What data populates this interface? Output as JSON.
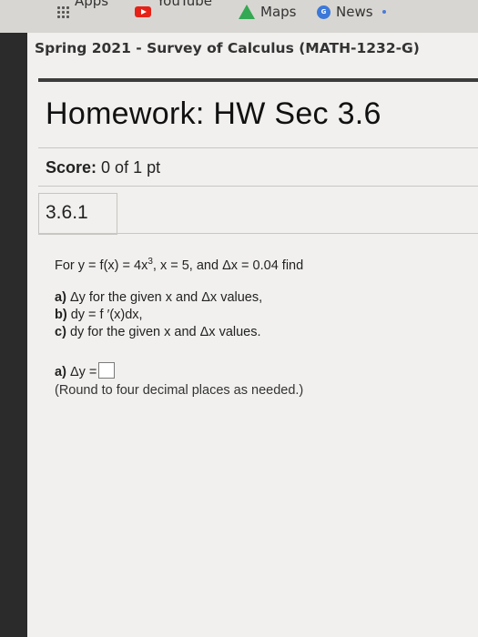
{
  "bookmarks": [
    {
      "label": "Apps",
      "icon": "apps-grid-icon"
    },
    {
      "label": "YouTube",
      "icon": "youtube-icon"
    },
    {
      "label": "Maps",
      "icon": "maps-icon"
    },
    {
      "label": "News",
      "icon": "news-icon"
    }
  ],
  "course": {
    "title": "Spring 2021 - Survey of Calculus (MATH-1232-G)"
  },
  "homework": {
    "title": "Homework: HW Sec 3.6"
  },
  "score": {
    "label": "Score:",
    "value": "0 of 1 pt"
  },
  "question": {
    "number": "3.6.1",
    "prompt_start": "For y = f(x) = 4x",
    "prompt_exp": "3",
    "prompt_end": ", x = 5, and Δx = 0.04 find",
    "parts": [
      {
        "label": "a)",
        "text": "Δy for the given x and Δx values,"
      },
      {
        "label": "b)",
        "text": "dy = f ′(x)dx,"
      },
      {
        "label": "c)",
        "text": "dy for the given x and Δx values."
      }
    ],
    "answer_label": "a)",
    "answer_text": "Δy =",
    "answer_value": "",
    "hint": "(Round to four decimal places as needed.)"
  }
}
